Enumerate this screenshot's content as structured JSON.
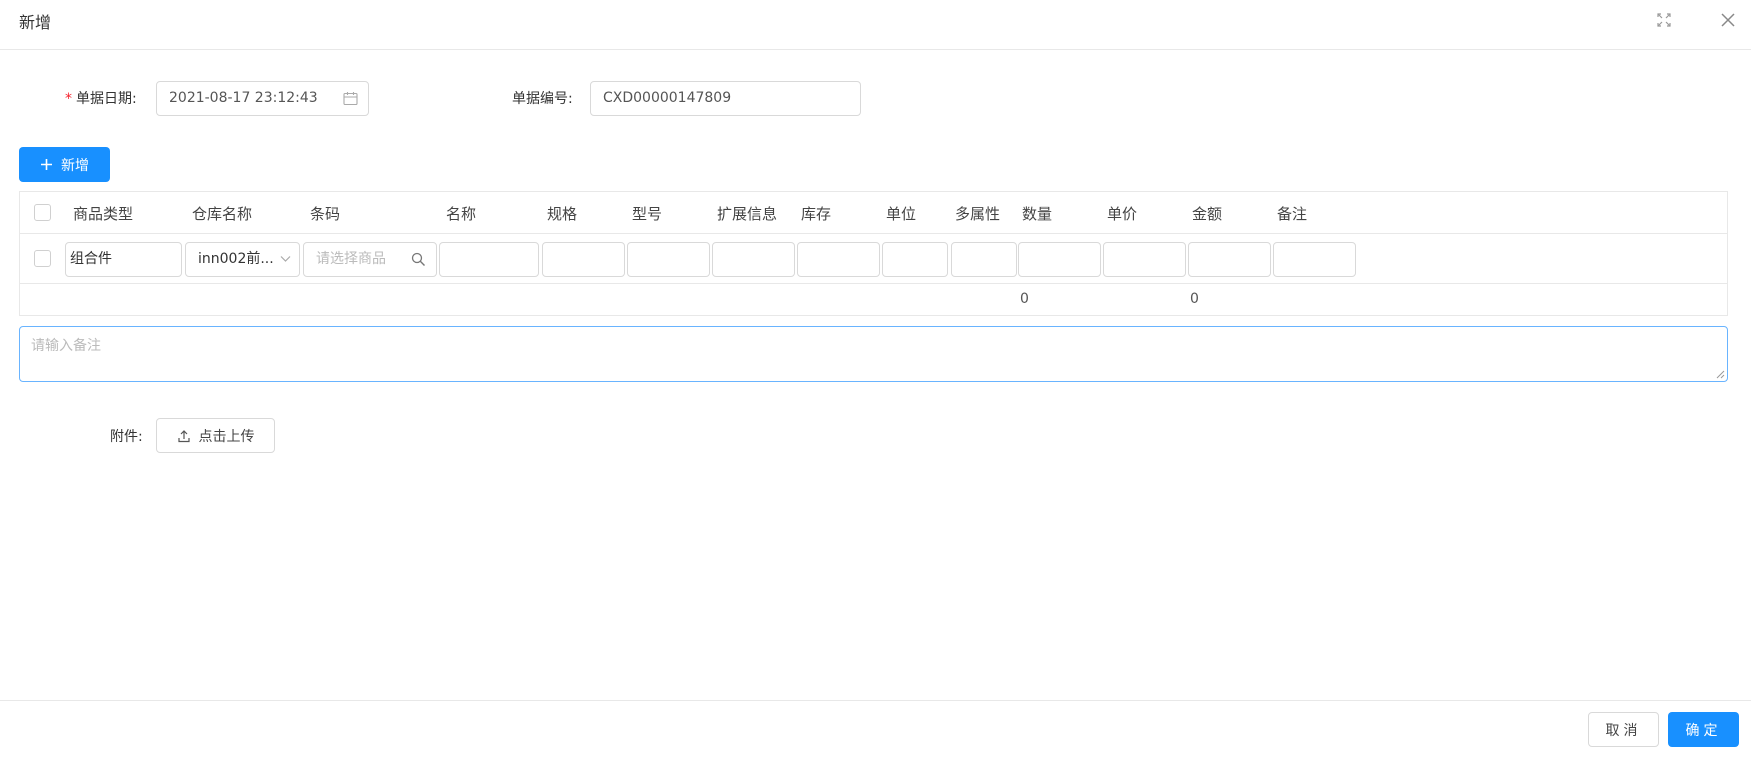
{
  "dialog": {
    "title": "新增"
  },
  "form": {
    "date_label": "单据日期:",
    "date_required_mark": "*",
    "date_value": "2021-08-17 23:12:43",
    "code_label": "单据编号:",
    "code_value": "CXD00000147809"
  },
  "toolbar": {
    "add_label": "新增"
  },
  "table": {
    "columns": [
      "商品类型",
      "仓库名称",
      "条码",
      "名称",
      "规格",
      "型号",
      "扩展信息",
      "库存",
      "单位",
      "多属性",
      "数量",
      "单价",
      "金额",
      "备注"
    ],
    "row": {
      "product_type": "组合件",
      "warehouse": "inn002前...",
      "barcode_placeholder": "请选择商品"
    },
    "summary": {
      "quantity_total": "0",
      "amount_total": "0"
    }
  },
  "remark": {
    "placeholder": "请输入备注"
  },
  "attachment": {
    "label": "附件:",
    "upload_label": "点击上传"
  },
  "footer": {
    "cancel_label": "取消",
    "ok_label": "确定"
  },
  "colors": {
    "primary": "#1890ff",
    "required": "#f5222d",
    "border": "#d9d9d9",
    "focus_border": "#69b4ff"
  },
  "icons": {
    "fullscreen": "fullscreen-icon",
    "close": "close-icon",
    "calendar": "calendar-icon",
    "plus": "plus-icon",
    "chevron": "chevron-down-icon",
    "search": "search-icon",
    "upload": "upload-icon"
  }
}
